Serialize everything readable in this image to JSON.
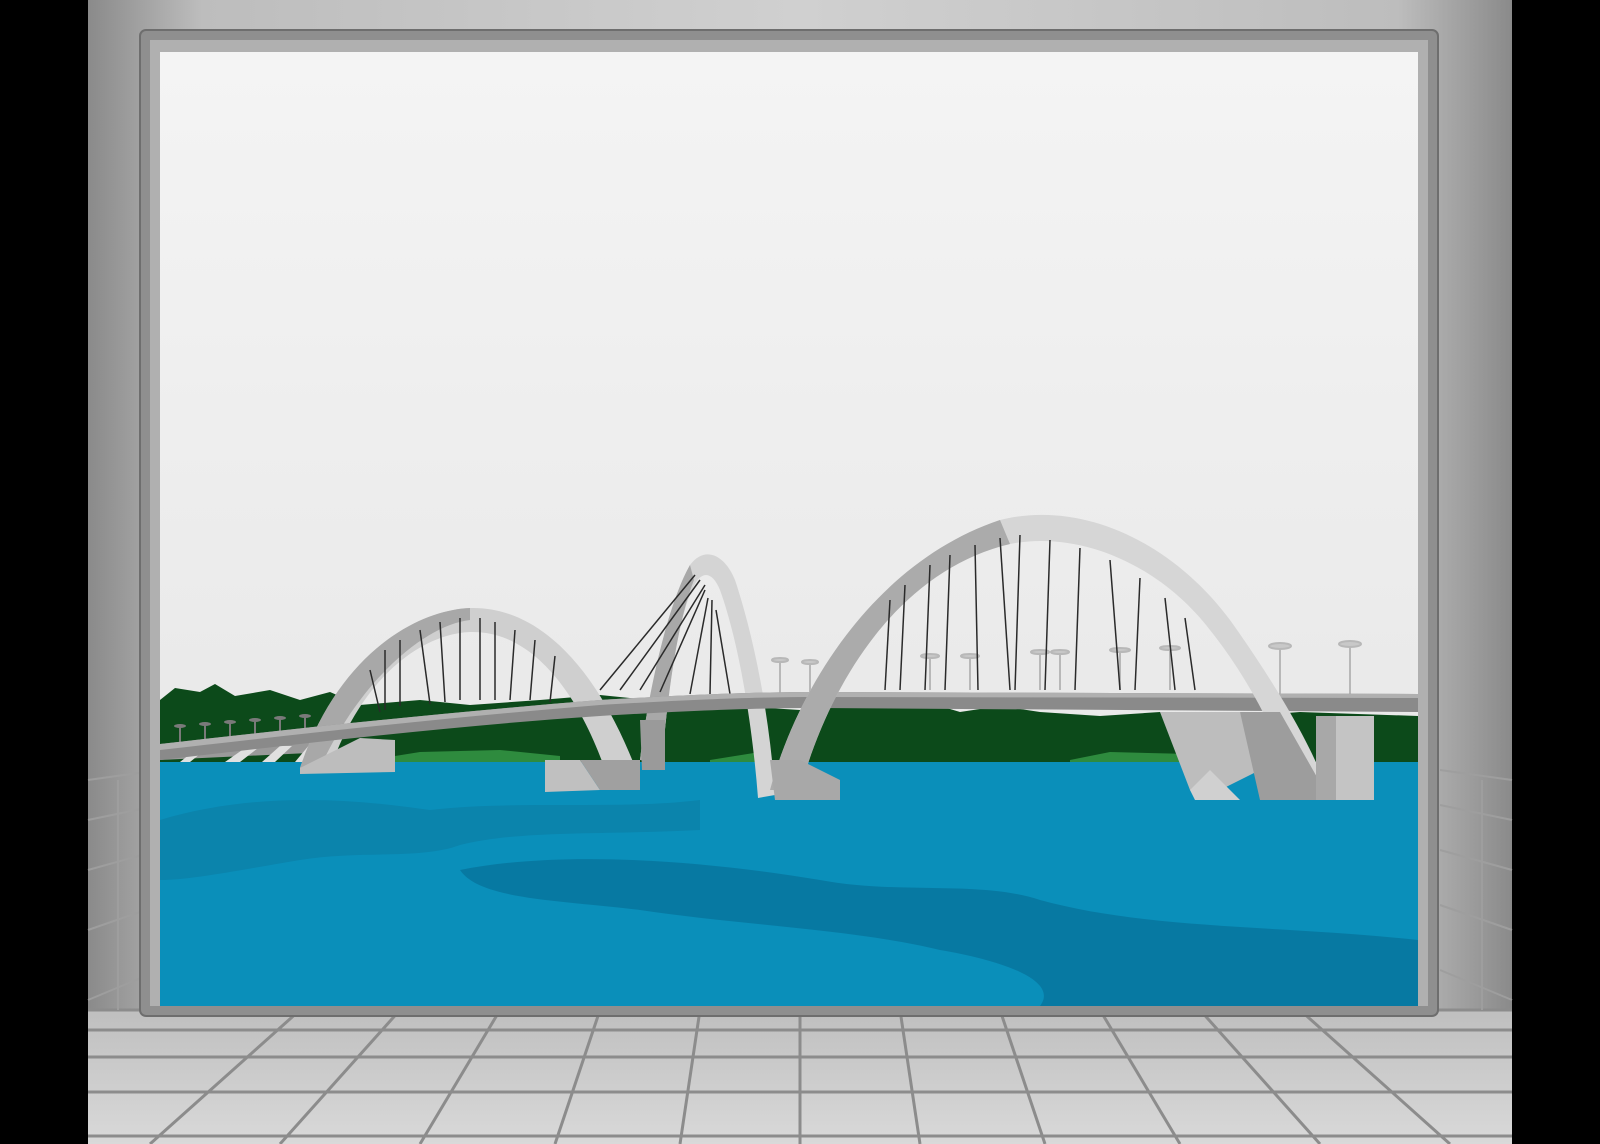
{
  "scene": {
    "subject": "bridge-with-three-arches-over-lake",
    "colors": {
      "letterbox": "#000000",
      "wall": "#a9a9a9",
      "frame_outer": "#8c8c8c",
      "frame_inner": "#b4b4b4",
      "sky_top": "#f3f3f3",
      "sky_bottom": "#e8e8e8",
      "water": "#0a8fba",
      "water_shade": "#07729a",
      "trees": "#0c4a1a",
      "grass": "#2e8b3e",
      "arch_light": "#d9d9d9",
      "arch_mid": "#b5b5b5",
      "arch_dark": "#8f8f8f",
      "deck": "#8a8a8a",
      "cable": "#2a2a2a",
      "floor_tile": "#cfcfcf",
      "floor_line": "#8a8a8a"
    }
  }
}
